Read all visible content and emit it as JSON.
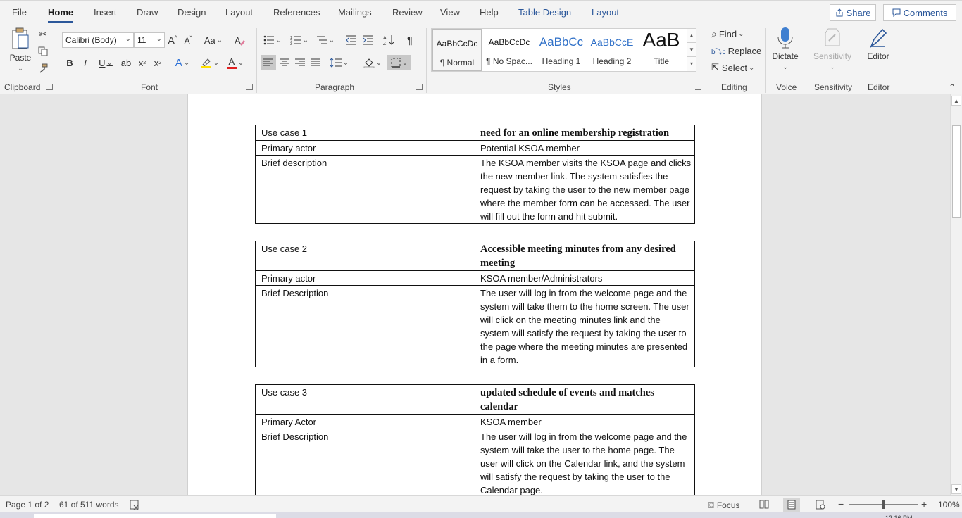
{
  "tabs": [
    {
      "label": "File",
      "active": false
    },
    {
      "label": "Home",
      "active": true
    },
    {
      "label": "Insert",
      "active": false
    },
    {
      "label": "Draw",
      "active": false
    },
    {
      "label": "Design",
      "active": false
    },
    {
      "label": "Layout",
      "active": false
    },
    {
      "label": "References",
      "active": false
    },
    {
      "label": "Mailings",
      "active": false
    },
    {
      "label": "Review",
      "active": false
    },
    {
      "label": "View",
      "active": false
    },
    {
      "label": "Help",
      "active": false
    },
    {
      "label": "Table Design",
      "active": false
    },
    {
      "label": "Layout",
      "active": false
    }
  ],
  "header_buttons": {
    "share": "Share",
    "comments": "Comments"
  },
  "ribbon": {
    "clipboard": {
      "group_label": "Clipboard",
      "paste": "Paste"
    },
    "font": {
      "group_label": "Font",
      "font_name": "Calibri (Body)",
      "font_size": "11",
      "change_case": "Aa",
      "bold": "B",
      "italic": "I",
      "underline": "U",
      "strike": "ab",
      "subscript": "x",
      "superscript": "x",
      "font_color_letter": "A"
    },
    "paragraph": {
      "group_label": "Paragraph"
    },
    "styles": {
      "group_label": "Styles",
      "items": [
        {
          "preview": "AaBbCcDc",
          "name": "¶ Normal"
        },
        {
          "preview": "AaBbCcDc",
          "name": "¶ No Spac..."
        },
        {
          "preview": "AaBbCc",
          "name": "Heading 1"
        },
        {
          "preview": "AaBbCcE",
          "name": "Heading 2"
        },
        {
          "preview": "AaB",
          "name": "Title"
        }
      ]
    },
    "editing": {
      "group_label": "Editing",
      "find": "Find",
      "replace": "Replace",
      "select": "Select"
    },
    "voice": {
      "group_label": "Voice",
      "dictate": "Dictate"
    },
    "sensitivity": {
      "group_label": "Sensitivity",
      "button": "Sensitivity"
    },
    "editor": {
      "group_label": "Editor",
      "button": "Editor"
    }
  },
  "document": {
    "tables": [
      {
        "rows": [
          [
            "Use case 1",
            "need for an online membership registration"
          ],
          [
            "Primary actor",
            "Potential KSOA member"
          ],
          [
            "Brief description",
            "The KSOA member visits the KSOA page and clicks the new member link. The system satisfies the request by taking the user to the new member page where the member form can be accessed. The user will fill out the form and hit submit."
          ]
        ]
      },
      {
        "rows": [
          [
            "Use case 2",
            "Accessible meeting minutes from any desired meeting"
          ],
          [
            "Primary actor",
            "KSOA member/Administrators"
          ],
          [
            "Brief Description",
            "The user will log in from the welcome page and the system will take them to the home screen. The user will click on the meeting minutes link and the system will satisfy the request by taking the user to the page where the meeting minutes are presented in a form."
          ]
        ]
      },
      {
        "rows": [
          [
            "Use case 3",
            "updated schedule of events and matches calendar"
          ],
          [
            "Primary Actor",
            "KSOA member"
          ],
          [
            "Brief Description",
            "The user will log in from the welcome page and the system will take the user to the home page. The user will click on the Calendar link, and the system will satisfy the request by taking the user to the Calendar page."
          ]
        ]
      }
    ]
  },
  "statusbar": {
    "page": "Page 1 of 2",
    "words": "61 of 511 words",
    "focus": "Focus",
    "zoom": "100%"
  },
  "taskbar": {
    "clock": "12:16 PM"
  },
  "colors": {
    "accent": "#2b579a",
    "ribbon_bg": "#f3f3f3",
    "doc_bg": "#e6e6e6"
  }
}
